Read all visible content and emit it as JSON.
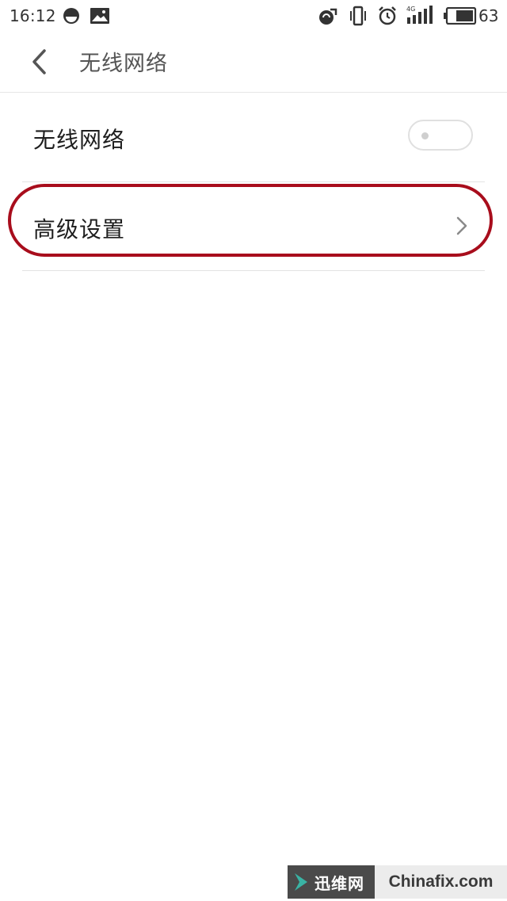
{
  "status_bar": {
    "time": "16:12",
    "battery_level": "63",
    "network_type": "4G",
    "icons": [
      "clock-mode-icon",
      "image-notification-icon",
      "sync-icon",
      "vibrate-icon",
      "alarm-icon",
      "signal-icon",
      "battery-icon"
    ]
  },
  "header": {
    "title": "无线网络",
    "back_icon": "back-arrow-icon"
  },
  "settings": {
    "wifi": {
      "label": "无线网络",
      "enabled": false
    },
    "advanced": {
      "label": "高级设置",
      "icon": "chevron-right-icon"
    }
  },
  "colors": {
    "annotation": "#a80d1c",
    "divider": "#e3e3e3",
    "title_text": "#555555"
  },
  "watermark": {
    "cn_text": "迅维网",
    "en_text": "Chinafix.com"
  }
}
